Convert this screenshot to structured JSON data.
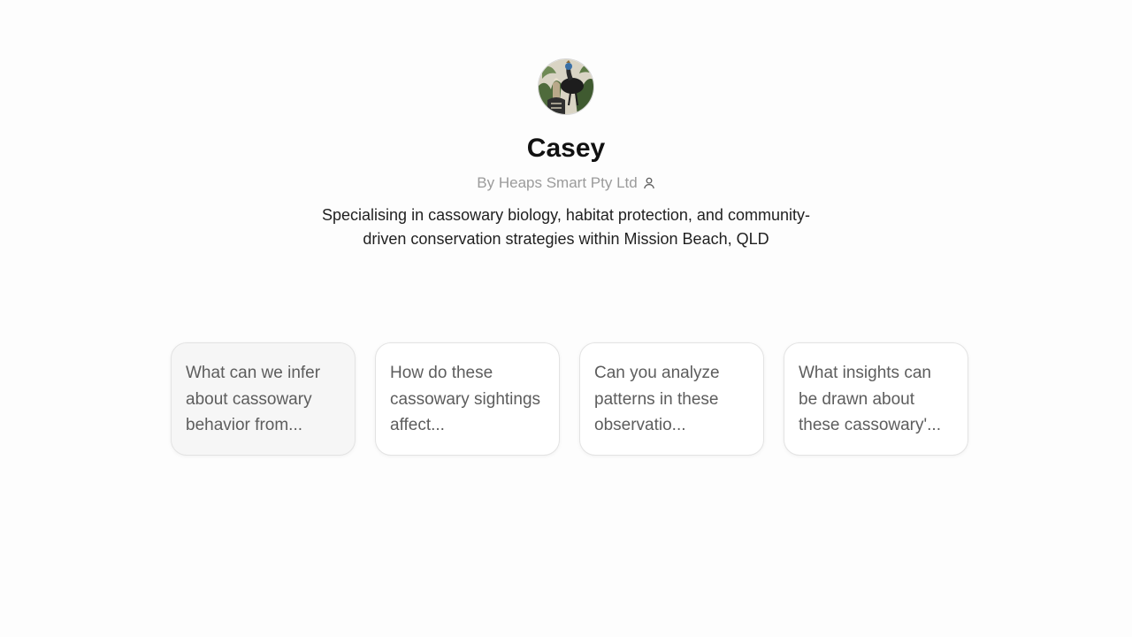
{
  "gpt": {
    "name": "Casey",
    "byline": "By Heaps Smart Pty Ltd",
    "author_icon": "person-icon",
    "avatar_icon": "cassowary-avatar",
    "description": "Specialising in cassowary biology, habitat protection, and community-driven conservation strategies within Mission Beach, QLD"
  },
  "starters": [
    {
      "text": "What can we infer about cassowary behavior from..."
    },
    {
      "text": "How do these cassowary sightings affect..."
    },
    {
      "text": "Can you analyze patterns in these observatio..."
    },
    {
      "text": "What insights can be drawn about these cassowary'..."
    }
  ]
}
